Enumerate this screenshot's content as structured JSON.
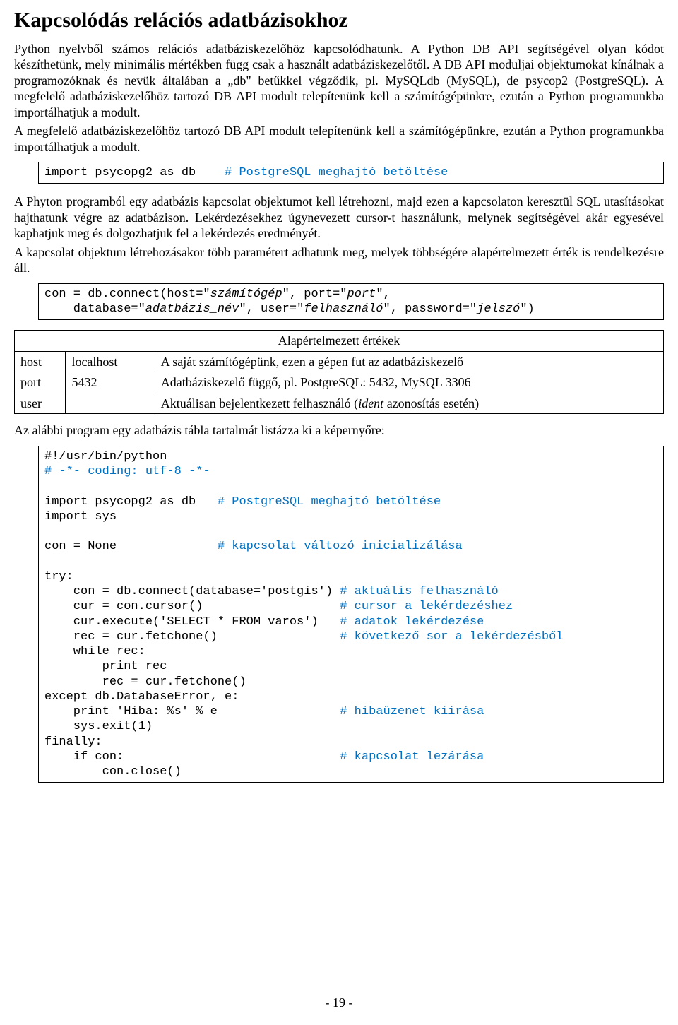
{
  "title": "Kapcsolódás relációs adatbázisokhoz",
  "para1": "Python nyelvből számos relációs adatbáziskezelőhöz kapcsolódhatunk. A Python DB API segítségével olyan kódot készíthetünk, mely minimális mértékben függ csak a használt adatbáziskezelőtől. A DB API moduljai objektumokat kínálnak a programozóknak és nevük általában a „db\" betűkkel végződik, pl. MySQLdb (MySQL), de psycop2 (PostgreSQL). A megfelelő adatbáziskezelőhöz tartozó DB API modult telepítenünk kell a számítógépünkre, ezután a Python programunkba importálhatjuk a modult.",
  "para2": "A megfelelő adatbáziskezelőhöz tartozó DB API modult telepítenünk kell a számítógépünkre, ezután a Python programunkba importálhatjuk a modult.",
  "code1": {
    "line1a": "import psycopg2 as db    ",
    "line1b": "# PostgreSQL meghajtó betöltése"
  },
  "para3": "A Phyton programból egy adatbázis kapcsolat objektumot kell létrehozni, majd ezen a kapcsolaton keresztül SQL utasításokat hajthatunk végre az adatbázison. Lekérdezésekhez úgynevezett cursor-t használunk, melynek segítségével akár egyesével kaphatjuk meg és dolgozhatjuk fel a lekérdezés eredményét.",
  "para4": "A kapcsolat objektum létrehozásakor több paramétert adhatunk meg, melyek többségére alapértelmezett érték is rendelkezésre áll.",
  "code2": {
    "l1a": "con = db.connect(host=\"",
    "l1b": "számítógép",
    "l1c": "\", port=\"",
    "l1d": "port",
    "l1e": "\",",
    "l2a": "    database=\"",
    "l2b": "adatbázis_név",
    "l2c": "\", user=\"",
    "l2d": "felhasználó",
    "l2e": "\", password=\"",
    "l2f": "jelszó",
    "l2g": "\")"
  },
  "table": {
    "header": "Alapértelmezett értékek",
    "rows": [
      {
        "k": "host",
        "v": "localhost",
        "d": "A saját számítógépünk, ezen a gépen fut az adatbáziskezelő"
      },
      {
        "k": "port",
        "v": "5432",
        "d": "Adatbáziskezelő függő, pl. PostgreSQL: 5432, MySQL 3306"
      }
    ],
    "row3": {
      "k": "user",
      "v": "",
      "d1": "Aktuálisan bejelentkezett felhasználó (",
      "d2": "ident",
      "d3": " azonosítás esetén)"
    }
  },
  "para5": "Az alábbi program egy adatbázis tábla tartalmát listázza ki a képernyőre:",
  "code3": {
    "l1": "#!/usr/bin/python",
    "l2": "# -*- coding: utf-8 -*-",
    "l3a": "import psycopg2 as db   ",
    "l3b": "# PostgreSQL meghajtó betöltése",
    "l4": "import sys",
    "l5a": "con = None              ",
    "l5b": "# kapcsolat változó inicializálása",
    "l6": "try:",
    "l7a": "    con = db.connect(database='postgis') ",
    "l7b": "# aktuális felhasználó",
    "l8a": "    cur = con.cursor()                   ",
    "l8b": "# cursor a lekérdezéshez",
    "l9a": "    cur.execute('SELECT * FROM varos')   ",
    "l9b": "# adatok lekérdezése",
    "l10a": "    rec = cur.fetchone()                 ",
    "l10b": "# következő sor a lekérdezésből",
    "l11": "    while rec:",
    "l12": "        print rec",
    "l13": "        rec = cur.fetchone()",
    "l14": "except db.DatabaseError, e:",
    "l15a": "    print 'Hiba: %s' % e                 ",
    "l15b": "# hibaüzenet kiírása",
    "l16": "    sys.exit(1)",
    "l17": "finally:",
    "l18a": "    if con:                              ",
    "l18b": "# kapcsolat lezárása",
    "l19": "        con.close()"
  },
  "footer": "- 19 -"
}
